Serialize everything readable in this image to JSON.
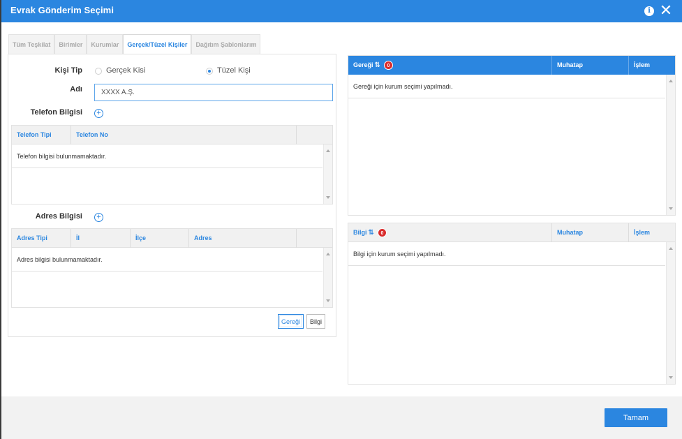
{
  "window": {
    "title": "Evrak Gönderim Seçimi"
  },
  "tabs": [
    {
      "label": "Tüm Teşkilat",
      "active": false
    },
    {
      "label": "Birimler",
      "active": false
    },
    {
      "label": "Kurumlar",
      "active": false
    },
    {
      "label": "Gerçek/Tüzel Kişiler",
      "active": true
    },
    {
      "label": "Dağıtım Şablonlarım",
      "active": false
    }
  ],
  "form": {
    "kisi_tip_label": "Kişi Tip",
    "radio_gercek_label": "Gerçek Kisi",
    "radio_tuzel_label": "Tüzel Kişi",
    "selected_type": "Tüzel Kişi",
    "adi_label": "Adı",
    "adi_value": "XXXX A.Ş.",
    "telefon_label": "Telefon Bilgisi",
    "adres_label": "Adres Bilgisi"
  },
  "telefon_grid": {
    "columns": [
      "Telefon Tipi",
      "Telefon No"
    ],
    "empty_text": "Telefon bilgisi bulunmamaktadır."
  },
  "adres_grid": {
    "columns": [
      "Adres Tipi",
      "İl",
      "İlçe",
      "Adres"
    ],
    "empty_text": "Adres bilgisi bulunmamaktadır."
  },
  "buttons": {
    "geregi": "Gereği",
    "bilgi": "Bilgi",
    "ok": "Tamam"
  },
  "geregi_grid": {
    "title": "Gereği",
    "count": "0",
    "col_muhatap": "Muhatap",
    "col_islem": "İşlem",
    "empty_text": "Gereği için kurum seçimi yapılmadı."
  },
  "bilgi_grid": {
    "title": "Bilgi",
    "count": "0",
    "col_muhatap": "Muhatap",
    "col_islem": "İşlem",
    "empty_text": "Bilgi için kurum seçimi yapılmadı."
  },
  "icons": [
    "info-icon",
    "close-icon",
    "plus-circle-icon",
    "sort-icon",
    "scroll-up-icon",
    "scroll-down-icon"
  ],
  "colors": {
    "accent": "#2b86e0",
    "badge": "#d92b2b"
  }
}
